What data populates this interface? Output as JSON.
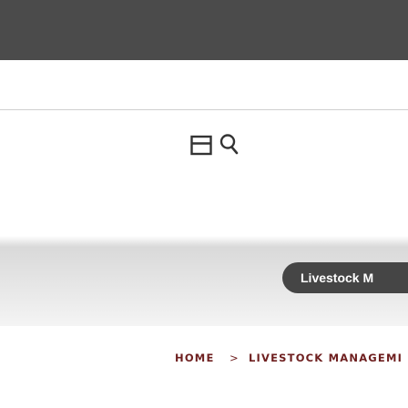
{
  "header": {
    "menu_icon": "hamburger-menu-icon",
    "search_icon": "search-icon"
  },
  "banner": {
    "label": "Livestock M"
  },
  "breadcrumb": {
    "home": "HOME",
    "separator": ">",
    "current": "LIVESTOCK MANAGEMI"
  },
  "colors": {
    "top_bar": "#4b4b4b",
    "breadcrumb_text": "#6e1f1f",
    "banner_label_bg": "#454545"
  }
}
